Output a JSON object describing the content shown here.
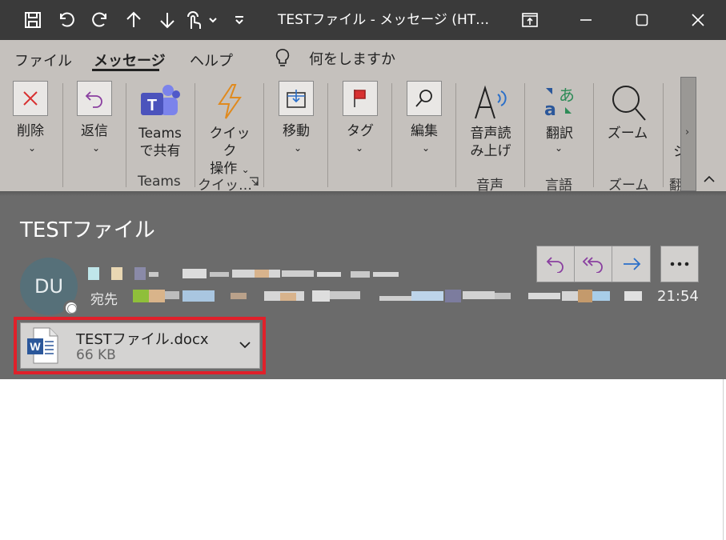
{
  "window": {
    "title": "TESTファイル  -  メッセージ (HT…"
  },
  "qat": {
    "icons": [
      "save-icon",
      "undo-icon",
      "redo-icon",
      "up-arrow-icon",
      "down-arrow-icon",
      "touch-mode-icon",
      "chevron-down-icon",
      "customize-qat-icon"
    ]
  },
  "menu": {
    "tabs": [
      "ファイル",
      "メッセージ",
      "ヘルプ"
    ],
    "active_tab": "メッセージ",
    "tell_me": "何をしますか"
  },
  "ribbon": {
    "delete": "削除",
    "reply": "返信",
    "teams_line1": "Teams",
    "teams_line2": "で共有",
    "quick_line1": "クイック",
    "quick_line2": "操作",
    "move": "移動",
    "tags": "タグ",
    "edit": "編集",
    "read_aloud_line1": "音声読",
    "read_aloud_line2": "み上げ",
    "translate": "翻訳",
    "zoom": "ズーム",
    "cut_label": "シ",
    "groups": {
      "teams": "Teams",
      "quick": "クイッ…",
      "voice": "音声",
      "language": "言語",
      "zoom": "ズーム",
      "cut": "翻"
    }
  },
  "message": {
    "subject": "TESTファイル",
    "avatar_initials": "DU",
    "to_label": "宛先",
    "time": "21:54"
  },
  "attachment": {
    "name": "TESTファイル.docx",
    "size": "66 KB"
  },
  "colors": {
    "highlight": "#e0202a",
    "reply_icon": "#8a3fa0",
    "forward_icon": "#2a6fc9",
    "word_blue": "#2b579a"
  }
}
